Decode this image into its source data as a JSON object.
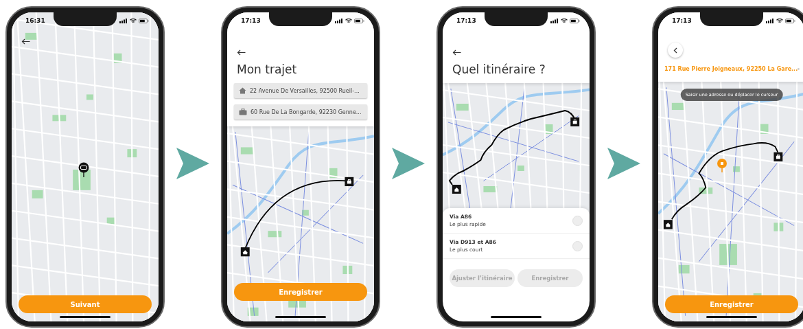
{
  "screens": [
    {
      "kind": "map_pin",
      "time": "16:31",
      "button": "Suivant"
    },
    {
      "kind": "trip",
      "time": "17:13",
      "title": "Mon trajet",
      "addresses": [
        {
          "kind": "home",
          "text": "22 Avenue De Versailles, 92500 Rueil-..."
        },
        {
          "kind": "work",
          "text": "60 Rue De La Bongarde, 92230 Genne..."
        }
      ],
      "button": "Enregistrer"
    },
    {
      "kind": "routes",
      "time": "17:13",
      "title": "Quel itinéraire ?",
      "routes": [
        {
          "name": "Via A86",
          "note": "Le plus rapide",
          "selected": false
        },
        {
          "name": "Via D913 et A86",
          "note": "Le plus court",
          "selected": false
        }
      ],
      "buttons": [
        {
          "label": "Ajuster l’itinéraire",
          "disabled": true
        },
        {
          "label": "Enregistrer",
          "disabled": true
        }
      ]
    },
    {
      "kind": "address_picker",
      "time": "17:13",
      "address": "171 Rue Pierre Joigneaux, 92250 La Gare...",
      "tooltip": "Saisir une adresse ou déplacer le curseur",
      "button": "Enregistrer"
    }
  ]
}
